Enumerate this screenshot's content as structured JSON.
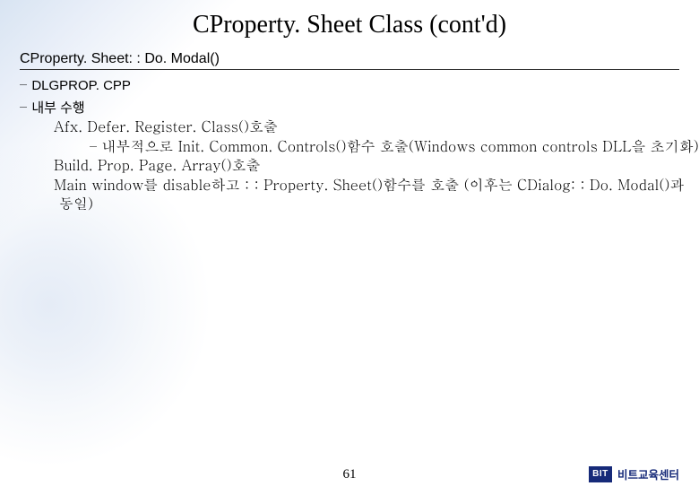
{
  "title": "CProperty. Sheet Class (cont'd)",
  "subtitle": "CProperty. Sheet: : Do. Modal()",
  "bullets": {
    "b1": "DLGPROP. CPP",
    "b2": "내부 수행"
  },
  "level2": {
    "i1": "Afx. Defer. Register. Class()호출",
    "i1_sub": "내부적으로 Init. Common. Controls()함수 호출(Windows common controls DLL을 초기화)",
    "i2": "Build. Prop. Page. Array()호출",
    "i3": "Main window를 disable하고 : : Property. Sheet()함수를 호출 (이후는 CDialog: : Do. Modal()과 동일)"
  },
  "pageNumber": "61",
  "logo": {
    "badge": "BIT",
    "text": "비트교육센터"
  }
}
